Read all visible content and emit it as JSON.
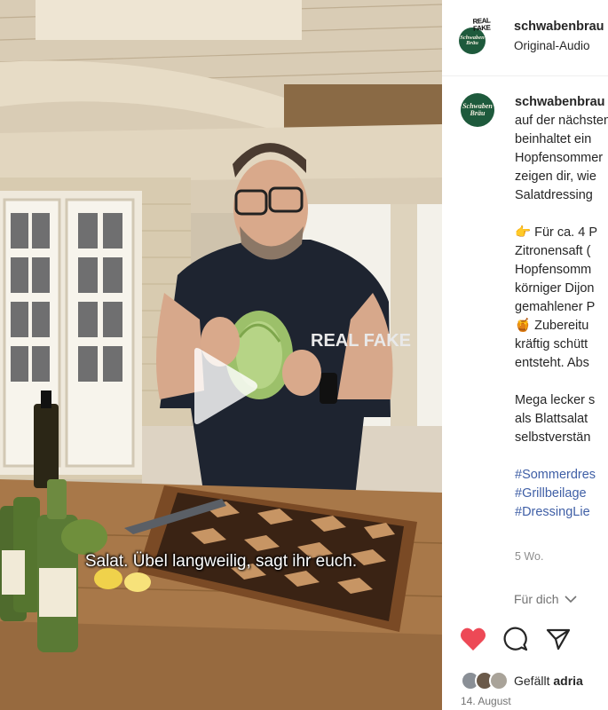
{
  "post": {
    "username": "schwabenbrau",
    "audio_label": "Original-Audio",
    "avatar_text": "Schwaben Bräu",
    "badge_text": "REAL FAKE"
  },
  "video": {
    "subtitle": "Salat. Übel langweilig, sagt ihr euch.",
    "shirt_text": "REAL FAKE"
  },
  "caption": {
    "username": "schwabenbrau",
    "lines": [
      "auf der nächsten",
      "beinhaltet ein",
      "Hopfensommer",
      "zeigen dir, wie",
      "Salatdressing"
    ],
    "ingredients_lines": [
      "👉 Für ca. 4 P",
      "Zitronensaft (",
      "Hopfensomm",
      "körniger Dijon",
      "gemahlener P",
      "🍯 Zubereitu",
      "kräftig schütt",
      "entsteht. Abs"
    ],
    "closing_lines": [
      "Mega lecker s",
      "als Blattsalat",
      "selbstverstän"
    ],
    "hashtags": [
      "#Sommerdres",
      "#Grillbeilage",
      "#DressingLie"
    ],
    "age": "5 Wo."
  },
  "more": {
    "label": "Für dich"
  },
  "likes": {
    "prefix": "Gefällt ",
    "user": "adria"
  },
  "date": "14. August",
  "colors": {
    "like_red": "#ed4956",
    "brand_green": "#1e5a3c",
    "hashtag_blue": "#3f5fa6"
  },
  "icons": [
    "play-icon",
    "heart-icon",
    "comment-icon",
    "share-icon",
    "chevron-down-icon"
  ]
}
